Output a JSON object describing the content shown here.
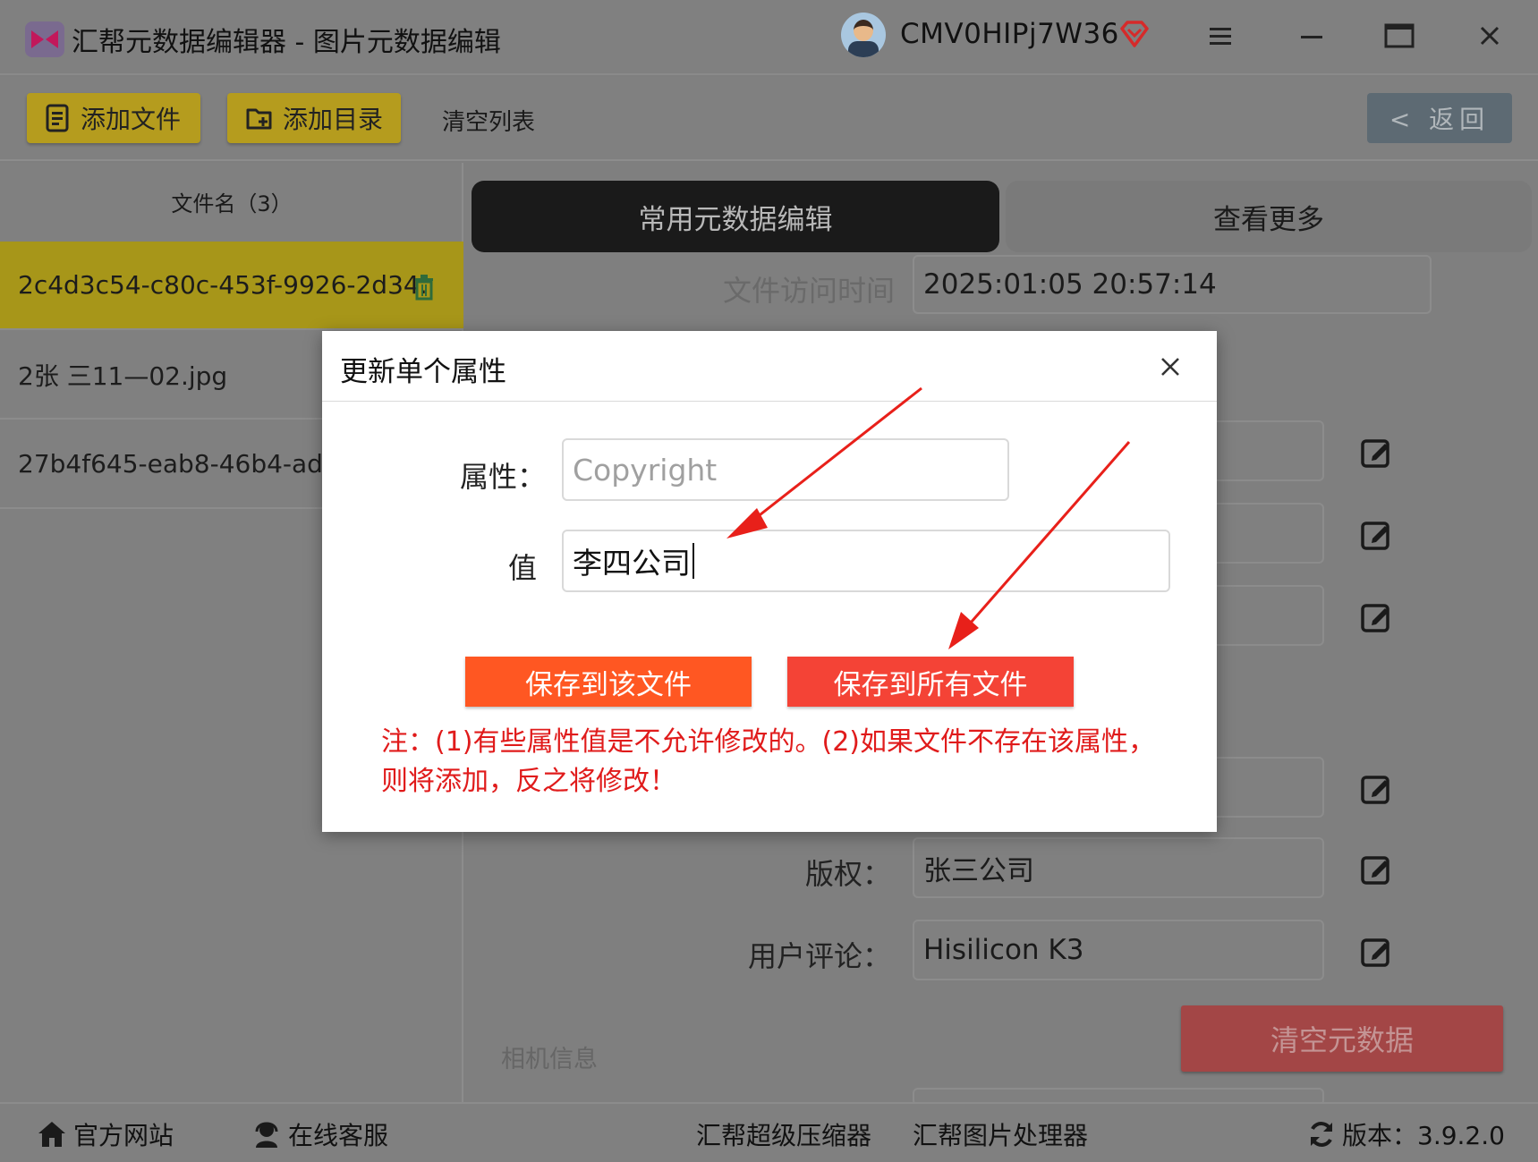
{
  "window": {
    "title": "汇帮元数据编辑器 - 图片元数据编辑",
    "username": "CMV0HIPj7W36"
  },
  "toolbar": {
    "add_file": "添加文件",
    "add_dir": "添加目录",
    "clear_list": "清空列表",
    "back": "< 返回"
  },
  "file_list": {
    "header": "文件名（3）",
    "items": [
      {
        "name": "2c4d3c54-c80c-453f-9926-2d34.."
      },
      {
        "name": "2张 三11—02.jpg"
      },
      {
        "name": "27b4f645-eab8-46b4-ad7"
      }
    ]
  },
  "tabs": {
    "common": "常用元数据编辑",
    "more": "查看更多"
  },
  "fields": {
    "access_time": {
      "label": "文件访问时间",
      "value": "2025:01:05 20:57:14"
    },
    "copyright": {
      "label": "版权：",
      "value": "张三公司"
    },
    "comment": {
      "label": "用户评论：",
      "value": "Hisilicon K3"
    }
  },
  "section": {
    "camera": "相机信息"
  },
  "actions": {
    "clear_metadata": "清空元数据"
  },
  "footer": {
    "website": "官方网站",
    "support": "在线客服",
    "compressor": "汇帮超级压缩器",
    "image_processor": "汇帮图片处理器",
    "version": "版本：3.9.2.0"
  },
  "dialog": {
    "title": "更新单个属性",
    "attr_label": "属性：",
    "attr_placeholder": "Copyright",
    "value_label": "值",
    "value": "李四公司",
    "save_one": "保存到该文件",
    "save_all": "保存到所有文件",
    "note": "注：(1)有些属性值是不允许修改的。(2)如果文件不存在该属性，则将添加，反之将修改！"
  },
  "colors": {
    "toolbar_button": "#b59c1e",
    "save_one": "#ff5722",
    "save_all": "#f44336",
    "note": "#e01b1b",
    "arrow": "#e8201a"
  }
}
